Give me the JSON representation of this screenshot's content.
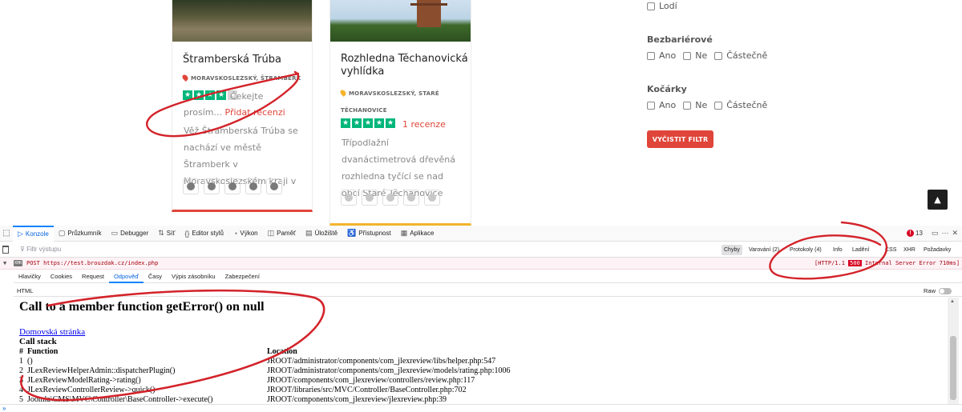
{
  "cards": [
    {
      "title": "Štramberská Trúba",
      "location": "MORAVSKOSLEZSKÝ, ŠTRAMBERK",
      "stars_filled": 4,
      "stars_total": 5,
      "waiting_text": "Čekejte prosím...",
      "add_review": "Přidat recenzi",
      "description": "Věž Štramberská Trúba se nachází ve městě Štramberk v Moravskoslezském kraji v"
    },
    {
      "title": "Rozhledna Těchanovická vyhlídka",
      "location": "MORAVSKOSLEZSKÝ, STARÉ TĚCHANOVICE",
      "stars_filled": 5,
      "stars_total": 5,
      "reviews": "1 recenze",
      "description": "Třípodlažní dvanáctimetrová dřevěná rozhledna tyčící se nad obcí Staré Těchanovice"
    }
  ],
  "filters": {
    "boats_label": "Lodí",
    "barrier_free": {
      "title": "Bezbariérové",
      "options": [
        "Ano",
        "Ne",
        "Částečně"
      ]
    },
    "strollers": {
      "title": "Kočárky",
      "options": [
        "Ano",
        "Ne",
        "Částečně"
      ]
    },
    "clear_button": "VYČISTIT FILTR"
  },
  "devtools": {
    "tabs": [
      {
        "label": "Konzole",
        "icon": "▷"
      },
      {
        "label": "Průzkumník",
        "icon": "▢"
      },
      {
        "label": "Debugger",
        "icon": "▭"
      },
      {
        "label": "Síť",
        "icon": "⇅"
      },
      {
        "label": "Editor stylů",
        "icon": "{}"
      },
      {
        "label": "Výkon",
        "icon": "◔"
      },
      {
        "label": "Paměť",
        "icon": "◫"
      },
      {
        "label": "Úložiště",
        "icon": "▤"
      },
      {
        "label": "Přístupnost",
        "icon": "♿"
      },
      {
        "label": "Aplikace",
        "icon": "▦"
      }
    ],
    "error_count": "13",
    "filter_placeholder": "Filtr výstupu",
    "filter_buttons": [
      "Chyby",
      "Varování (2)",
      "Protokoly (4)",
      "Info",
      "Ladění",
      "CSS",
      "XHR",
      "Požadavky"
    ],
    "request": {
      "method_url": "POST https://test.brouzdak.cz/index.php",
      "protocol": "[HTTP/1.1",
      "code": "500",
      "status_text": "Internal Server Error 710ms]",
      "tag": "XHR"
    },
    "sub_tabs": [
      "Hlavičky",
      "Cookies",
      "Request",
      "Odpověď",
      "Časy",
      "Výpis zásobníku",
      "Zabezpečení"
    ],
    "html_label": "HTML",
    "raw_label": "Raw",
    "response": {
      "heading": "Call to a member function getError() on null",
      "link": "Domovská stránka",
      "call_stack_title": "Call stack",
      "col_num": "#",
      "col_function": "Function",
      "col_location": "Location",
      "rows": [
        {
          "n": "1",
          "fn": "()",
          "loc": "JROOT/administrator/components/com_jlexreview/libs/helper.php:547"
        },
        {
          "n": "2",
          "fn": "JLexReviewHelperAdmin::dispatcherPlugin()",
          "loc": "JROOT/administrator/components/com_jlexreview/models/rating.php:1006"
        },
        {
          "n": "3",
          "fn": "JLexReviewModelRating->rating()",
          "loc": "JROOT/components/com_jlexreview/controllers/review.php:117"
        },
        {
          "n": "4",
          "fn": "JLexReviewControllerReview->quick()",
          "loc": "JROOT/libraries/src/MVC/Controller/BaseController.php:702"
        },
        {
          "n": "5",
          "fn": "Joomla\\CMS\\MVC\\Controller\\BaseController->execute()",
          "loc": "JROOT/components/com_jlexreview/jlexreview.php:39"
        }
      ]
    },
    "console_prompt": "»"
  }
}
